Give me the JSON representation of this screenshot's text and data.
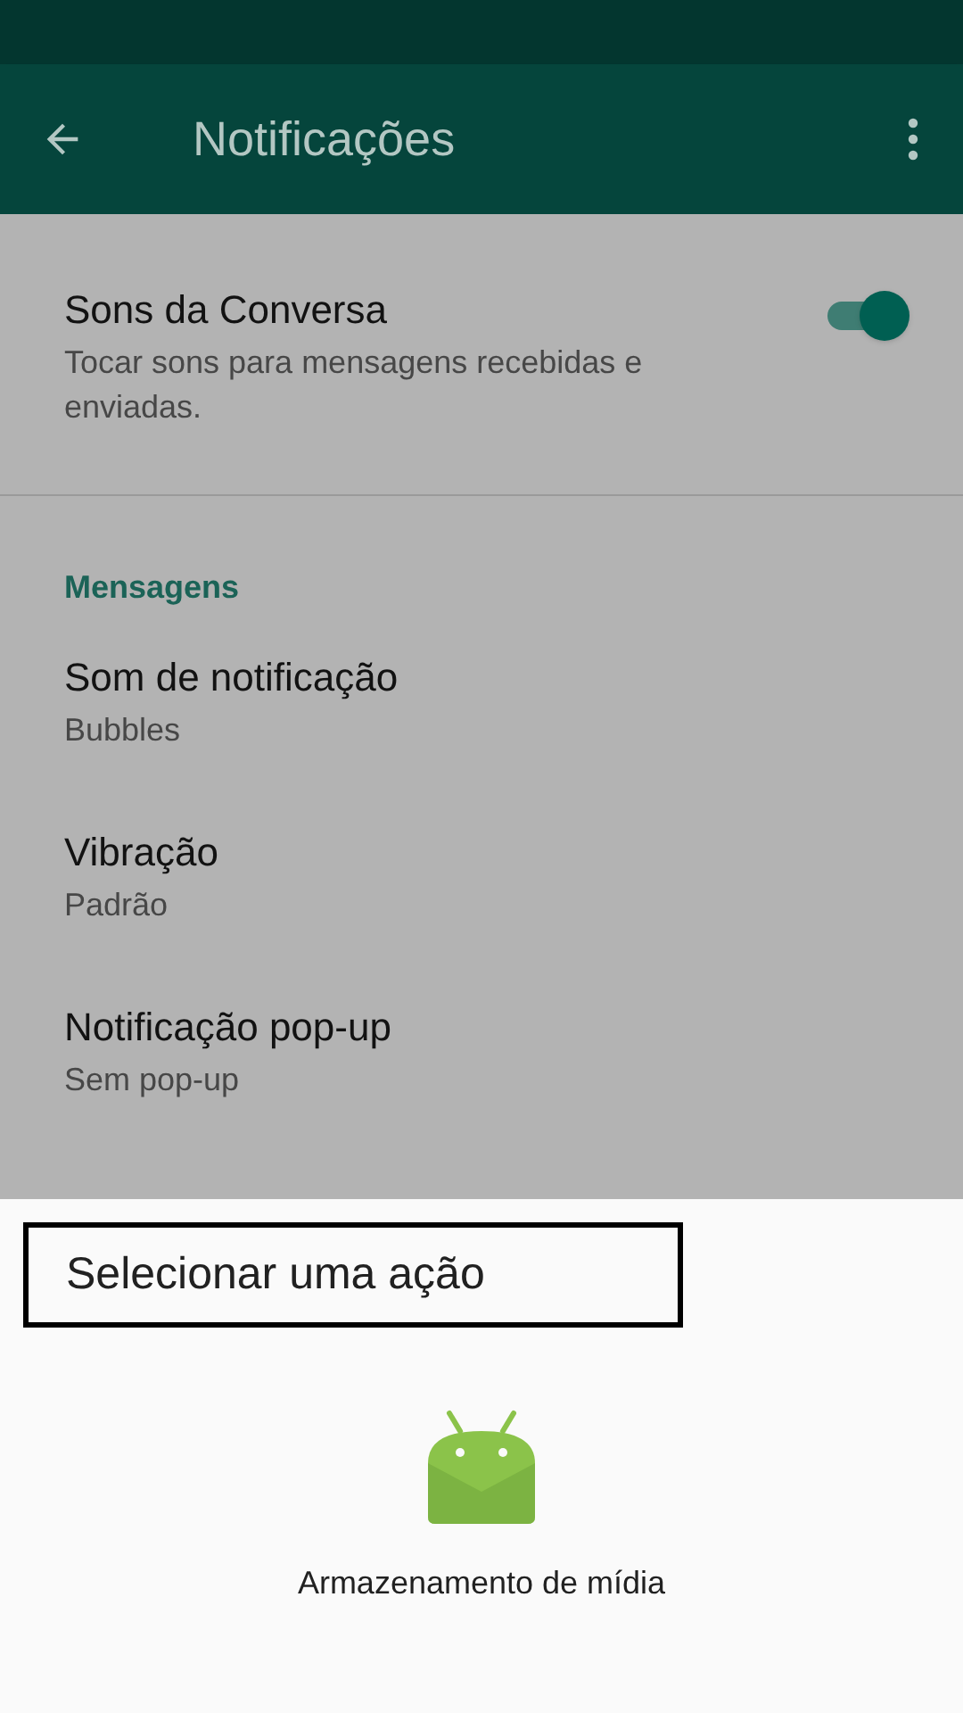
{
  "app_bar": {
    "title": "Notificações"
  },
  "toggle_setting": {
    "title": "Sons da Conversa",
    "subtitle": "Tocar sons para mensagens recebidas e enviadas.",
    "on": true
  },
  "section": "Mensagens",
  "items": [
    {
      "title": "Som de notificação",
      "value": "Bubbles"
    },
    {
      "title": "Vibração",
      "value": "Padrão"
    },
    {
      "title": "Notificação pop-up",
      "value": "Sem pop-up"
    }
  ],
  "sheet": {
    "title": "Selecionar uma ação",
    "apps": [
      {
        "label": "Armazenamento de mídia"
      }
    ]
  }
}
